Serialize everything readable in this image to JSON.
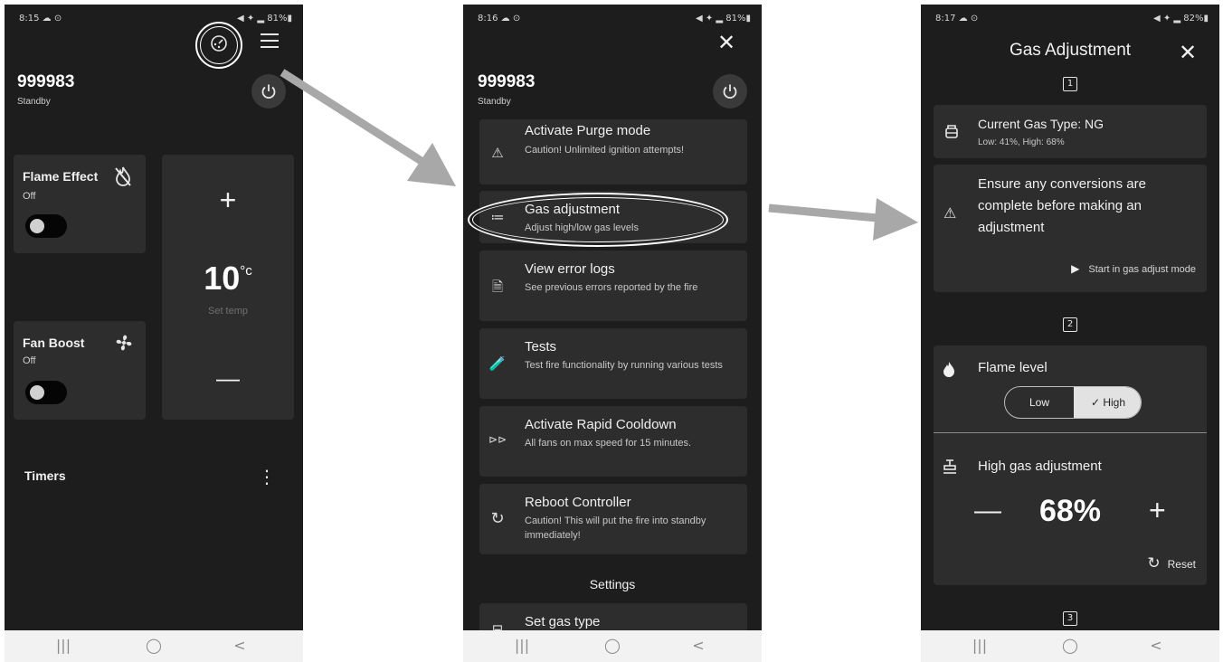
{
  "screen1": {
    "status_time": "8:15 ☁ ⊙",
    "status_right": "◀ ✦ ▂ 81%▮",
    "device_id": "999983",
    "device_state": "Standby",
    "flame_effect": {
      "label": "Flame Effect",
      "state": "Off"
    },
    "fan_boost": {
      "label": "Fan Boost",
      "state": "Off"
    },
    "temp_plus": "+",
    "temp_value": "10",
    "temp_unit": "°c",
    "temp_caption": "Set temp",
    "temp_minus": "—",
    "timers_label": "Timers",
    "kebab": "⋮"
  },
  "screen2": {
    "status_time": "8:16 ☁ ⊙",
    "status_right": "◀ ✦ ▂ 81%▮",
    "close": "✕",
    "device_id": "999983",
    "device_state": "Standby",
    "menu": [
      {
        "icon": "⚠",
        "title": "Activate Purge mode",
        "subtitle": "Caution! Unlimited ignition attempts!"
      },
      {
        "icon": "≔",
        "title": "Gas adjustment",
        "subtitle": "Adjust high/low gas levels"
      },
      {
        "icon": "🗎",
        "title": "View error logs",
        "subtitle": "See previous errors reported by the fire"
      },
      {
        "icon": "🧪",
        "title": "Tests",
        "subtitle": "Test fire functionality by running various tests"
      },
      {
        "icon": "⊳⊳",
        "title": "Activate Rapid Cooldown",
        "subtitle": "All fans on max speed for 15 minutes."
      },
      {
        "icon": "↻",
        "title": "Reboot Controller",
        "subtitle": "Caution! This will put the fire into standby immediately!"
      }
    ],
    "settings_header": "Settings",
    "set_gas_type": "Set gas type"
  },
  "screen3": {
    "status_time": "8:17 ☁ ⊙",
    "status_right": "◀ ✦ ▂ 82%▮",
    "title": "Gas Adjustment",
    "close": "✕",
    "step1": "1",
    "current_gas_title": "Current Gas Type: NG",
    "current_gas_sub": "Low: 41%, High: 68%",
    "warning_text": "Ensure any conversions are complete before making an adjustment",
    "start_mode": "Start in gas adjust mode",
    "step2": "2",
    "flame_level": "Flame level",
    "seg_low": "Low",
    "seg_high": "✓ High",
    "high_gas_label": "High gas adjustment",
    "minus": "—",
    "value": "68%",
    "plus": "+",
    "reset": "Reset",
    "step3": "3"
  },
  "navbar": {
    "recents": "|||",
    "home": "◯",
    "back": "<"
  },
  "colors": {
    "background": "#1d1d1d",
    "card": "#2d2d2d",
    "nav": "#f2f2f2",
    "arrow": "#a8a8a8"
  }
}
